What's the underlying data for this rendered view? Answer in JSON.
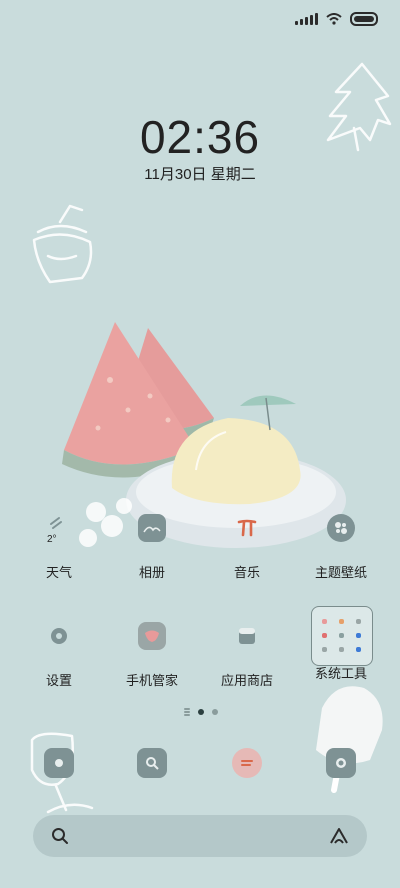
{
  "clock": {
    "time": "02:36",
    "date": "11月30日 星期二"
  },
  "weather": {
    "temp": "2°"
  },
  "apps_row1": [
    {
      "label": "天气",
      "icon": "weather-icon"
    },
    {
      "label": "相册",
      "icon": "gallery-icon"
    },
    {
      "label": "音乐",
      "icon": "music-icon"
    },
    {
      "label": "主题壁纸",
      "icon": "theme-icon"
    }
  ],
  "apps_row2": [
    {
      "label": "设置",
      "icon": "settings-icon"
    },
    {
      "label": "手机管家",
      "icon": "security-icon"
    },
    {
      "label": "应用商店",
      "icon": "app-store-icon"
    },
    {
      "label": "系统工具",
      "icon": "folder-icon"
    }
  ],
  "dock": [
    {
      "icon": "phone-icon"
    },
    {
      "icon": "browser-icon"
    },
    {
      "icon": "messages-icon"
    },
    {
      "icon": "camera-icon"
    }
  ],
  "colors": {
    "background": "#c9dcdc",
    "icon_base": "#7e9294",
    "accent_pink": "#e89a9a",
    "accent_orange": "#d9684a"
  }
}
